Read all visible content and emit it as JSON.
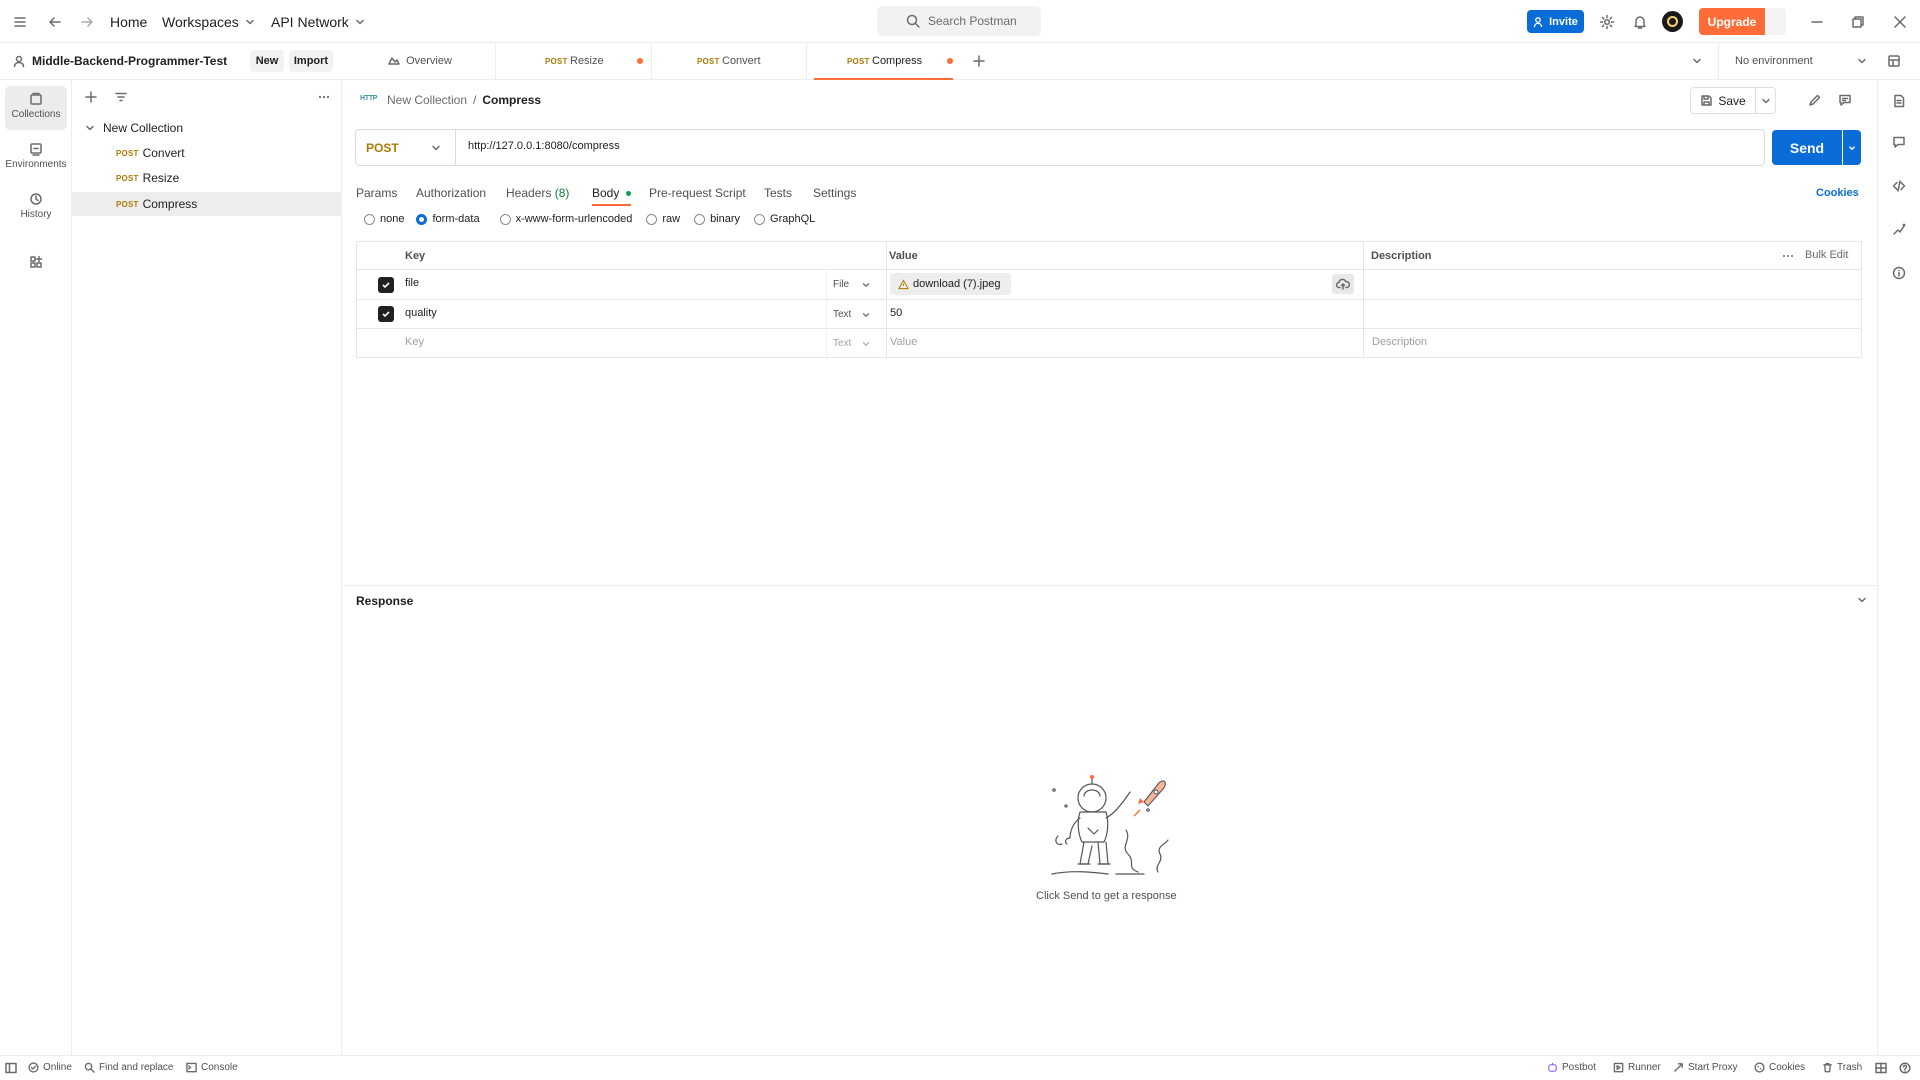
{
  "topbar": {
    "home": "Home",
    "workspaces": "Workspaces",
    "api_network": "API Network",
    "search_placeholder": "Search Postman",
    "invite": "Invite",
    "upgrade": "Upgrade"
  },
  "workspace": {
    "name": "Middle-Backend-Programmer-Test",
    "new_label": "New",
    "import_label": "Import"
  },
  "tabs": [
    {
      "method": "POST",
      "name": "Resize",
      "unsaved": true
    },
    {
      "method": "POST",
      "name": "Convert",
      "unsaved": false
    },
    {
      "method": "POST",
      "name": "Compress",
      "unsaved": true
    }
  ],
  "overview_tab": "Overview",
  "environment": "No environment",
  "rail": {
    "collections": "Collections",
    "environments": "Environments",
    "history": "History"
  },
  "sidebar": {
    "collection": "New Collection",
    "items": [
      {
        "method": "POST",
        "name": "Convert"
      },
      {
        "method": "POST",
        "name": "Resize"
      },
      {
        "method": "POST",
        "name": "Compress"
      }
    ]
  },
  "request": {
    "breadcrumb_parent": "New Collection",
    "breadcrumb_sep": "/",
    "breadcrumb_current": "Compress",
    "http_badge": "HTTP",
    "save": "Save",
    "method": "POST",
    "url": "http://127.0.0.1:8080/compress",
    "send": "Send"
  },
  "req_tabs": {
    "params": "Params",
    "authorization": "Authorization",
    "headers": "Headers",
    "headers_count": "(8)",
    "body": "Body",
    "prerequest": "Pre-request Script",
    "tests": "Tests",
    "settings": "Settings",
    "cookies": "Cookies"
  },
  "body_types": {
    "none": "none",
    "form_data": "form-data",
    "urlencoded": "x-www-form-urlencoded",
    "raw": "raw",
    "binary": "binary",
    "graphql": "GraphQL"
  },
  "form": {
    "headers": {
      "key": "Key",
      "value": "Value",
      "description": "Description",
      "bulk_edit": "Bulk Edit"
    },
    "rows": [
      {
        "key": "file",
        "type": "File",
        "value": "download (7).jpeg"
      },
      {
        "key": "quality",
        "type": "Text",
        "value": "50"
      }
    ],
    "placeholder": {
      "key": "Key",
      "type": "Text",
      "value": "Value",
      "description": "Description"
    }
  },
  "response": {
    "title": "Response",
    "empty_hint": "Click Send to get a response"
  },
  "status": {
    "online": "Online",
    "find_replace": "Find and replace",
    "console": "Console",
    "postbot": "Postbot",
    "runner": "Runner",
    "start_proxy": "Start Proxy",
    "cookies": "Cookies",
    "trash": "Trash"
  },
  "colors": {
    "orange": "#ff6c37",
    "blue": "#0a6cd6",
    "method_post": "#ad7a03"
  }
}
